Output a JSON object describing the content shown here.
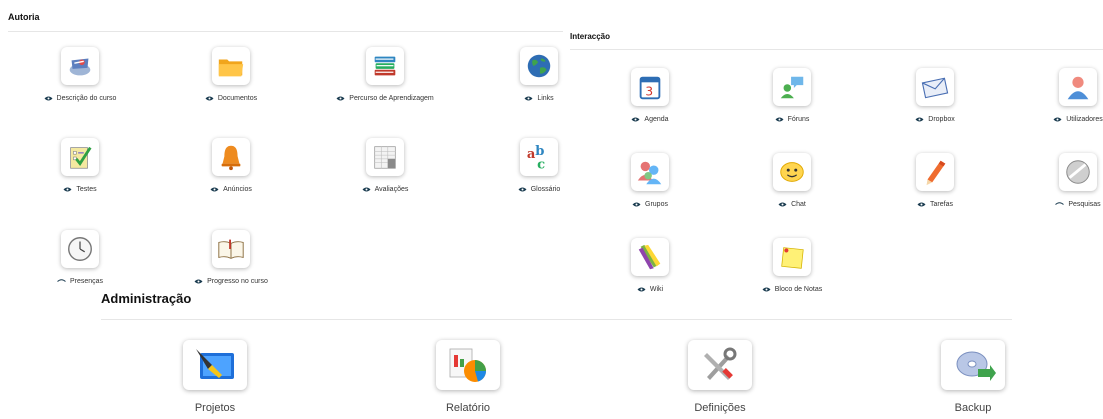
{
  "autoria": {
    "title": "Autoria",
    "tools": [
      {
        "label": "Descrição do curso",
        "icon": "course-description-icon",
        "visible": true
      },
      {
        "label": "Documentos",
        "icon": "folder-icon",
        "visible": true
      },
      {
        "label": "Percurso de Aprendizagem",
        "icon": "books-icon",
        "visible": true
      },
      {
        "label": "Links",
        "icon": "globe-icon",
        "visible": true
      },
      {
        "label": "Testes",
        "icon": "test-checklist-icon",
        "visible": true
      },
      {
        "label": "Anúncios",
        "icon": "bell-icon",
        "visible": true
      },
      {
        "label": "Avaliações",
        "icon": "spreadsheet-icon",
        "visible": true
      },
      {
        "label": "Glossário",
        "icon": "abc-icon",
        "visible": true
      },
      {
        "label": "Presenças",
        "icon": "clock-icon",
        "visible": false
      },
      {
        "label": "Progresso no curso",
        "icon": "open-book-icon",
        "visible": true
      }
    ]
  },
  "interaccao": {
    "title": "Interacção",
    "tools": [
      {
        "label": "Agenda",
        "icon": "calendar-icon",
        "visible": true
      },
      {
        "label": "Fóruns",
        "icon": "forum-icon",
        "visible": true
      },
      {
        "label": "Dropbox",
        "icon": "envelope-icon",
        "visible": true
      },
      {
        "label": "Utilizadores",
        "icon": "user-icon",
        "visible": true
      },
      {
        "label": "Grupos",
        "icon": "group-icon",
        "visible": true
      },
      {
        "label": "Chat",
        "icon": "chat-smiley-icon",
        "visible": true
      },
      {
        "label": "Tarefas",
        "icon": "pencil-icon",
        "visible": true
      },
      {
        "label": "Pesquisas",
        "icon": "survey-icon",
        "visible": false
      },
      {
        "label": "Wiki",
        "icon": "wiki-pencils-icon",
        "visible": true
      },
      {
        "label": "Bloco de Notas",
        "icon": "sticky-note-icon",
        "visible": true
      }
    ]
  },
  "administracao": {
    "title": "Administração",
    "tools": [
      {
        "label": "Projetos",
        "icon": "projects-icon"
      },
      {
        "label": "Relatório",
        "icon": "report-icon"
      },
      {
        "label": "Definições",
        "icon": "tools-icon"
      },
      {
        "label": "Backup",
        "icon": "backup-disc-icon"
      }
    ]
  },
  "colors": {
    "eye": "#1a3b4f",
    "title": "#111111",
    "rule": "#e6e6e6"
  }
}
